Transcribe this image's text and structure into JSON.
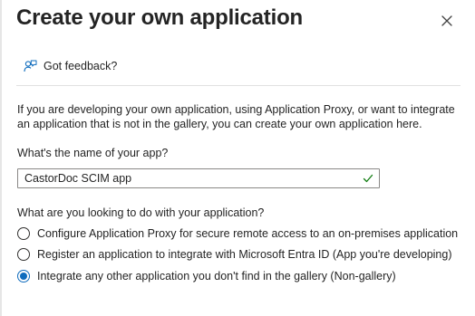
{
  "dialog": {
    "title": "Create your own application",
    "close_icon": "close-icon"
  },
  "toolbar": {
    "feedback_label": "Got feedback?",
    "feedback_icon": "feedback-person-icon"
  },
  "intro_text": "If you are developing your own application, using Application Proxy, or want to integrate an application that is not in the gallery, you can create your own application here.",
  "app_name": {
    "label": "What's the name of your app?",
    "value": "CastorDoc SCIM app",
    "valid_icon": "checkmark-icon"
  },
  "purpose": {
    "question": "What are you looking to do with your application?",
    "options": [
      {
        "label": "Configure Application Proxy for secure remote access to an on-premises application",
        "selected": false
      },
      {
        "label": "Register an application to integrate with Microsoft Entra ID (App you're developing)",
        "selected": false
      },
      {
        "label": "Integrate any other application you don't find in the gallery (Non-gallery)",
        "selected": true
      }
    ]
  },
  "colors": {
    "accent": "#0f6cbd",
    "valid_check": "#107c10",
    "text": "#242424"
  }
}
